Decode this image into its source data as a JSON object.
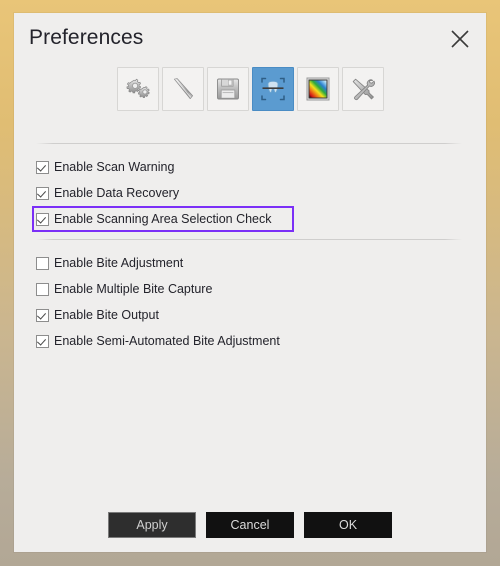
{
  "window": {
    "title": "Preferences",
    "frame_color_top": "#e9c578",
    "frame_color_bottom": "#b2a795",
    "background": "#efeeed"
  },
  "titlebar": {
    "close_icon": "close-icon",
    "close_label": "Close"
  },
  "toolbar": {
    "selected_index": 3,
    "buttons": [
      {
        "name": "general-settings",
        "icon": "gears-icon",
        "selected": false
      },
      {
        "name": "probe-tool",
        "icon": "probe-icon",
        "selected": false
      },
      {
        "name": "save-settings",
        "icon": "floppy-disk-icon",
        "selected": false
      },
      {
        "name": "scan-area",
        "icon": "scan-area-tooth-icon",
        "selected": true
      },
      {
        "name": "color-settings",
        "icon": "color-gradient-icon",
        "selected": false
      },
      {
        "name": "tools-settings",
        "icon": "wrench-screwdriver-icon",
        "selected": false
      }
    ]
  },
  "groups": [
    {
      "id": "group-scan",
      "options": [
        {
          "label": "Enable Scan Warning",
          "checked": true,
          "highlighted": false
        },
        {
          "label": "Enable Data Recovery",
          "checked": true,
          "highlighted": false
        },
        {
          "label": "Enable Scanning Area Selection Check",
          "checked": true,
          "highlighted": true
        }
      ]
    },
    {
      "id": "group-bite",
      "options": [
        {
          "label": "Enable Bite Adjustment",
          "checked": false,
          "highlighted": false
        },
        {
          "label": "Enable Multiple Bite Capture",
          "checked": false,
          "highlighted": false
        },
        {
          "label": "Enable Bite Output",
          "checked": true,
          "highlighted": false
        },
        {
          "label": "Enable Semi-Automated Bite Adjustment",
          "checked": true,
          "highlighted": false
        }
      ]
    }
  ],
  "footer": {
    "apply_label": "Apply",
    "cancel_label": "Cancel",
    "ok_label": "OK"
  },
  "highlight": {
    "color": "#7b2ff7"
  }
}
